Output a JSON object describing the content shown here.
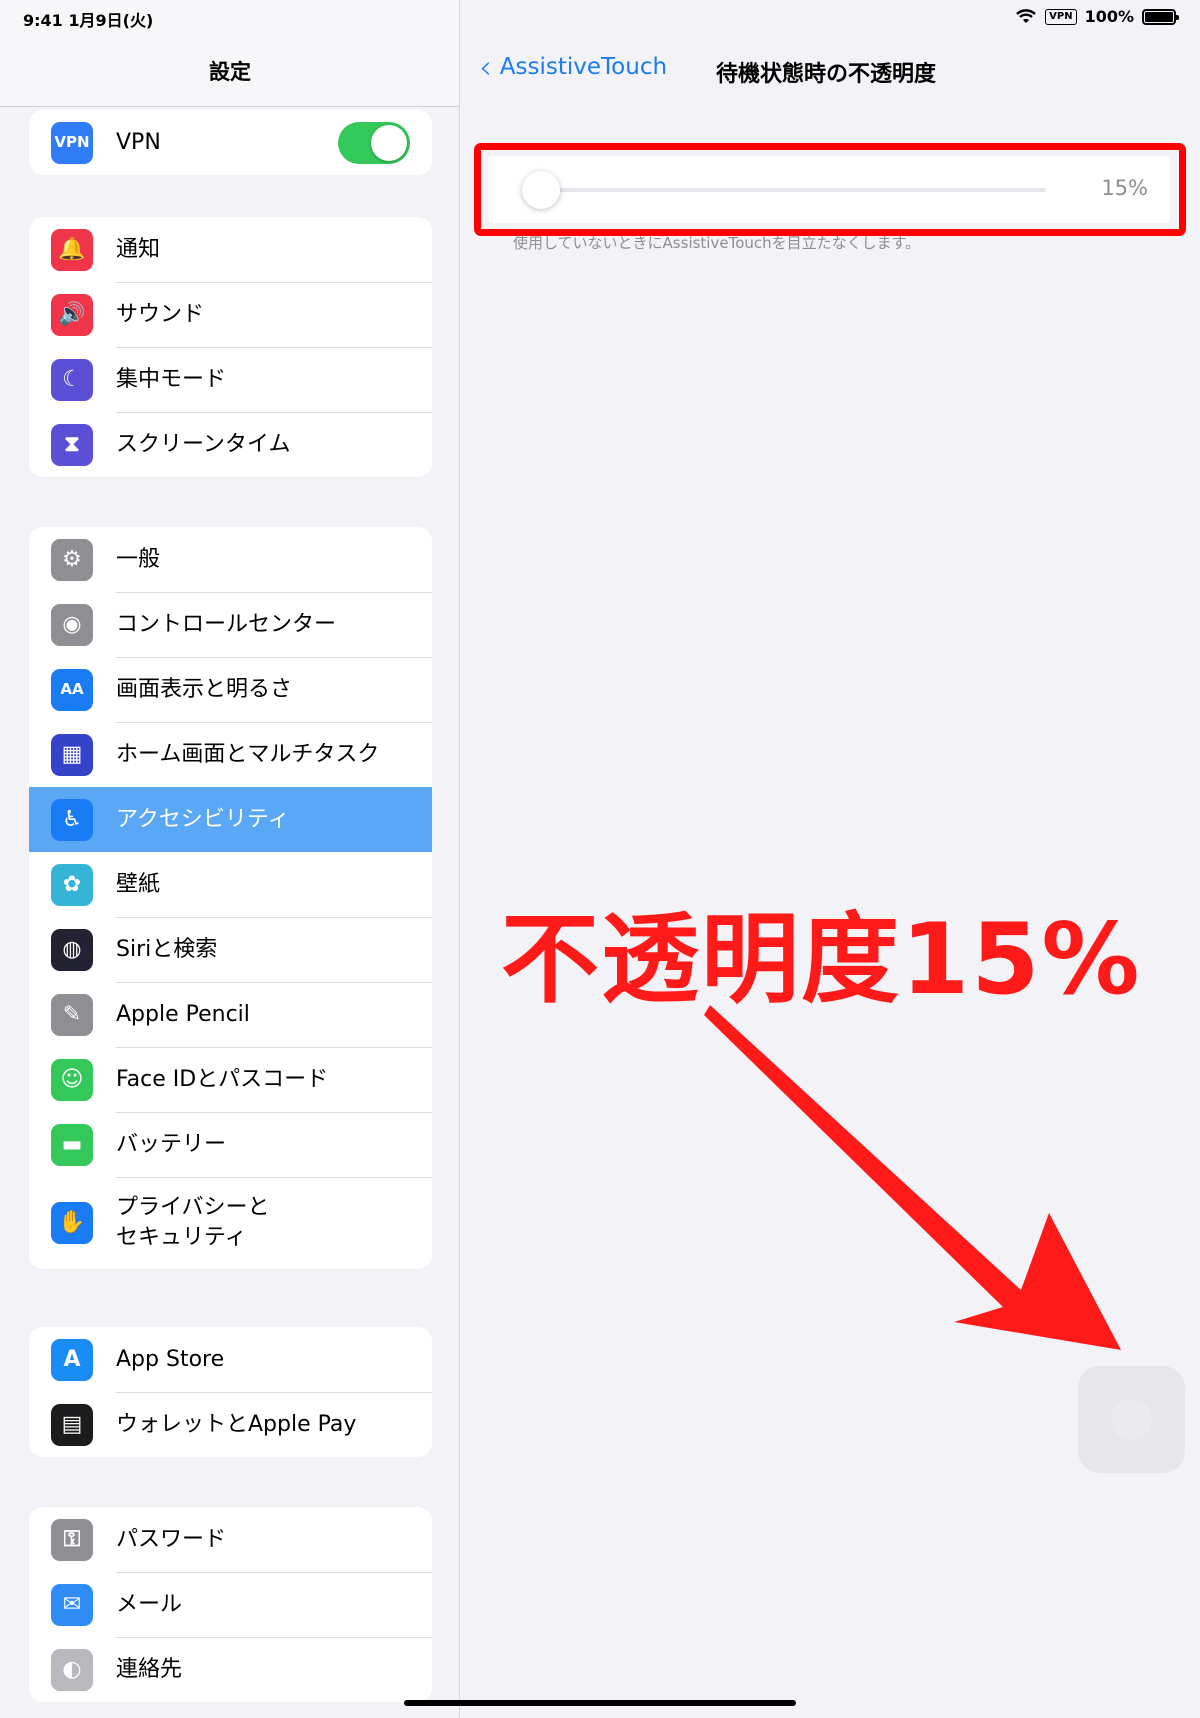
{
  "status": {
    "time_date": "9:41 1月9日(火)",
    "vpn": "VPN",
    "battery": "100%"
  },
  "sidebar": {
    "title": "設定",
    "groups": [
      [
        {
          "label": "VPN",
          "icon": "vpn-icon",
          "icon_text": "VPN",
          "color": "#2f7cf6",
          "toggle": true
        }
      ],
      [
        {
          "label": "通知",
          "icon": "bell-icon",
          "icon_text": "🔔",
          "color": "#f0344a"
        },
        {
          "label": "サウンド",
          "icon": "speaker-icon",
          "icon_text": "🔊",
          "color": "#f0344a"
        },
        {
          "label": "集中モード",
          "icon": "moon-icon",
          "icon_text": "☾",
          "color": "#5b4fd6"
        },
        {
          "label": "スクリーンタイム",
          "icon": "hourglass-icon",
          "icon_text": "⧗",
          "color": "#5b4fd6"
        }
      ],
      [
        {
          "label": "一般",
          "icon": "gear-icon",
          "icon_text": "⚙",
          "color": "#8e8e93"
        },
        {
          "label": "コントロールセンター",
          "icon": "toggles-icon",
          "icon_text": "◉",
          "color": "#8e8e93"
        },
        {
          "label": "画面表示と明るさ",
          "icon": "text-size-icon",
          "icon_text": "AA",
          "color": "#1a7cf5"
        },
        {
          "label": "ホーム画面とマルチタスク",
          "icon": "grid-icon",
          "icon_text": "▦",
          "color": "#3443c9"
        },
        {
          "label": "アクセシビリティ",
          "icon": "accessibility-icon",
          "icon_text": "♿",
          "color": "#1a7cf5",
          "selected": true
        },
        {
          "label": "壁紙",
          "icon": "flower-icon",
          "icon_text": "✿",
          "color": "#35b4d8"
        },
        {
          "label": "Siriと検索",
          "icon": "siri-icon",
          "icon_text": "◍",
          "color": "#222233"
        },
        {
          "label": "Apple Pencil",
          "icon": "pencil-icon",
          "icon_text": "✎",
          "color": "#8e8e93"
        },
        {
          "label": "Face IDとパスコード",
          "icon": "face-id-icon",
          "icon_text": "☺",
          "color": "#34c759"
        },
        {
          "label": "バッテリー",
          "icon": "battery-icon",
          "icon_text": "▬",
          "color": "#34c759"
        },
        {
          "label": "プライバシーと\nセキュリティ",
          "icon": "hand-icon",
          "icon_text": "✋",
          "color": "#1a7cf5",
          "tall": true
        }
      ],
      [
        {
          "label": "App Store",
          "icon": "app-store-icon",
          "icon_text": "A",
          "color": "#1a8cf5"
        },
        {
          "label": "ウォレットとApple Pay",
          "icon": "wallet-icon",
          "icon_text": "▤",
          "color": "#1c1c1e"
        }
      ],
      [
        {
          "label": "パスワード",
          "icon": "key-icon",
          "icon_text": "⚿",
          "color": "#8e8e93"
        },
        {
          "label": "メール",
          "icon": "mail-icon",
          "icon_text": "✉",
          "color": "#2f8cf6"
        },
        {
          "label": "連絡先",
          "icon": "contacts-icon",
          "icon_text": "◐",
          "color": "#b8b8bd"
        }
      ]
    ]
  },
  "detail": {
    "back_label": "AssistiveTouch",
    "title": "待機状態時の不透明度",
    "slider_value": "15%",
    "slider_fraction": 0.0,
    "footnote": "使用していないときにAssistiveTouchを目立たなくします。",
    "annotation": "不透明度15%"
  },
  "colors": {
    "accent": "#1a7cf5",
    "annotation_red": "#ff0000",
    "toggle_on": "#34c759"
  }
}
